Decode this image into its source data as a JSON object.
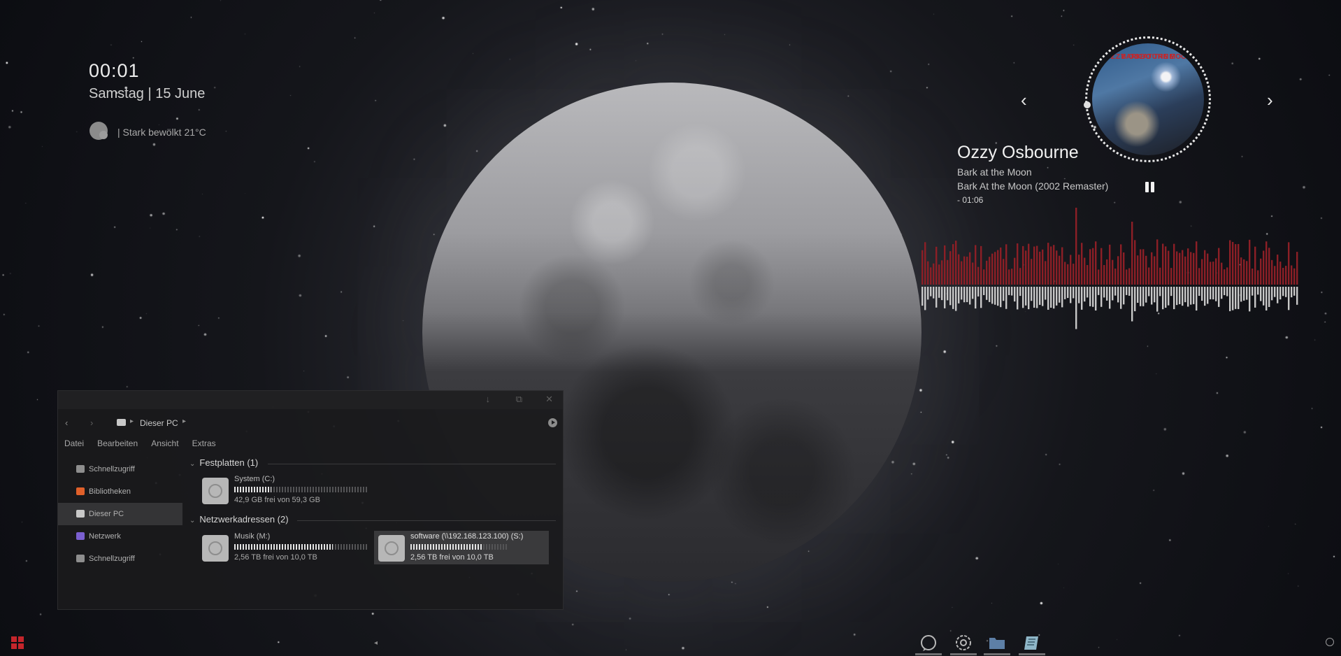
{
  "clock": {
    "time": "00:01",
    "date": "Samstag | 15 June",
    "weather": "| Stark bewölkt 21°C",
    "weather_icon": "cloud-icon"
  },
  "music": {
    "artist": "Ozzy Osbourne",
    "album": "Bark at the Moon",
    "track": "Bark At the Moon (2002 Remaster)",
    "time_remaining": "- 01:06",
    "prev_icon": "chevron-left-icon",
    "next_icon": "chevron-right-icon",
    "prev_label": "‹",
    "next_label": "›",
    "play_state": "playing",
    "album_art_text_left": "OZZY OSBOURNE",
    "album_art_text_right": "BARK AT THE MOON",
    "visualizer_colors": {
      "top": "#8c1f26",
      "bottom": "#c8c8c8"
    }
  },
  "explorer": {
    "title_buttons": [
      "minimize",
      "maximize",
      "close"
    ],
    "minimize_label": "↓",
    "maximize_label": "⧉",
    "close_label": "✕",
    "back_label": "‹",
    "forward_label": "›",
    "address": "Dieser PC",
    "address_sep": "▸",
    "address_sep2": "▸",
    "menu": [
      "Datei",
      "Bearbeiten",
      "Ansicht",
      "Extras"
    ],
    "sidebar": [
      {
        "label": "Schnellzugriff",
        "icon": "quick-access-icon",
        "color": "#8e8e8e"
      },
      {
        "label": "Bibliotheken",
        "icon": "libraries-icon",
        "color": "#e0602a"
      },
      {
        "label": "Dieser PC",
        "icon": "this-pc-icon",
        "color": "#c8c8c8",
        "active": true
      },
      {
        "label": "Netzwerk",
        "icon": "network-icon",
        "color": "#7a5fd0"
      },
      {
        "label": "Schnellzugriff",
        "icon": "quick-access-icon",
        "color": "#8e8e8e"
      }
    ],
    "sections": [
      {
        "header": "Festplatten (1)",
        "chevron": "⌄"
      },
      {
        "header": "Netzwerkadressen (2)",
        "chevron": "⌄"
      }
    ],
    "drives": [
      {
        "name": "System (C:)",
        "free": "42,9 GB frei von 59,3 GB",
        "used_fraction": 0.28
      },
      {
        "name": "Musik (M:)",
        "free": "2,56 TB frei von 10,0 TB",
        "used_fraction": 0.74
      },
      {
        "name": "software (\\\\192.168.123.100) (S:)",
        "free": "2,56 TB frei von 10,0 TB",
        "used_fraction": 0.74,
        "selected": true
      }
    ]
  },
  "taskbar": {
    "start_color": "#c4252b",
    "apps": [
      {
        "name": "chat-icon"
      },
      {
        "name": "settings-gear-icon"
      },
      {
        "name": "folder-icon"
      },
      {
        "name": "notebook-icon"
      }
    ],
    "tray": "settings-tray-icon",
    "mark": "◂"
  }
}
